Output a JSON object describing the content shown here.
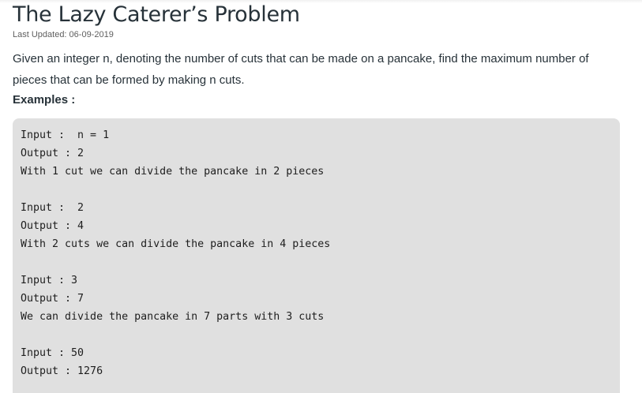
{
  "article": {
    "title": "The Lazy Caterer’s Problem",
    "last_updated": "Last Updated: 06-09-2019",
    "intro": "Given an integer n, denoting the number of cuts that can be made on a pancake, find the maximum number of pieces that can be formed by making n cuts.",
    "examples_heading": "Examples :"
  },
  "examples": {
    "lines": [
      "Input :  n = 1",
      "Output : 2",
      "With 1 cut we can divide the pancake in 2 pieces",
      "",
      "Input :  2",
      "Output : 4",
      "With 2 cuts we can divide the pancake in 4 pieces",
      "",
      "Input : 3",
      "Output : 7",
      "We can divide the pancake in 7 parts with 3 cuts",
      "",
      "Input : 50",
      "Output : 1276"
    ]
  },
  "colors": {
    "text": "#273239",
    "code_background": "#e0e0e0",
    "code_text": "#1e1e1e"
  }
}
